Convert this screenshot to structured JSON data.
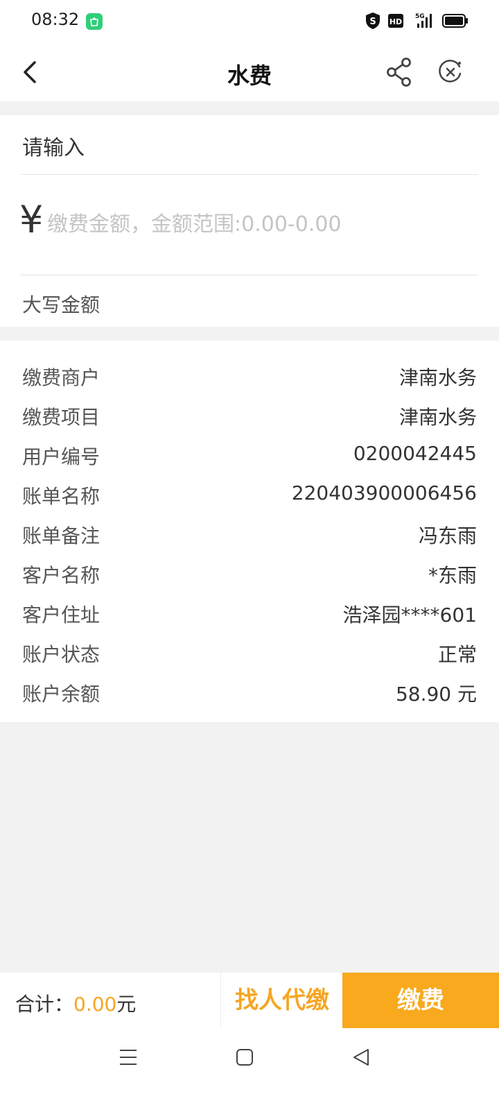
{
  "status_bar": {
    "time": "08:32",
    "icons": [
      "app-notification-icon",
      "shield-icon",
      "hd-icon",
      "5g-signal-icon",
      "battery-icon"
    ],
    "hd_label": "HD",
    "network_label": "5G"
  },
  "nav": {
    "title": "水费",
    "icons": [
      "back-icon",
      "share-icon",
      "close-icon"
    ]
  },
  "payment_input": {
    "title": "请输入",
    "currency_symbol": "¥",
    "amount_value": "",
    "amount_placeholder": "缴费金额，金额范围:0.00-0.00",
    "capital_label": "大写金额"
  },
  "bill_info": {
    "rows": [
      {
        "label": "缴费商户",
        "value": "津南水务"
      },
      {
        "label": "缴费项目",
        "value": "津南水务"
      },
      {
        "label": "用户编号",
        "value": "0200042445"
      },
      {
        "label": "账单名称",
        "value": "220403900006456"
      },
      {
        "label": "账单备注",
        "value": "冯东雨"
      },
      {
        "label": "客户名称",
        "value": "*东雨"
      },
      {
        "label": "客户住址",
        "value": "浩泽园****601"
      },
      {
        "label": "账户状态",
        "value": "正常"
      },
      {
        "label": "账户余额",
        "value": "58.90 元"
      }
    ]
  },
  "bottom_bar": {
    "total_prefix": "合计：",
    "total_amount": "0.00",
    "total_unit": "元",
    "proxy_pay_label": "找人代缴",
    "pay_label": "缴费"
  },
  "colors": {
    "accent": "#f8a91d",
    "accent_text": "#f5a623",
    "background": "#f2f2f2"
  },
  "system_nav": {
    "icons": [
      "menu-icon",
      "home-icon",
      "back-triangle-icon"
    ]
  }
}
